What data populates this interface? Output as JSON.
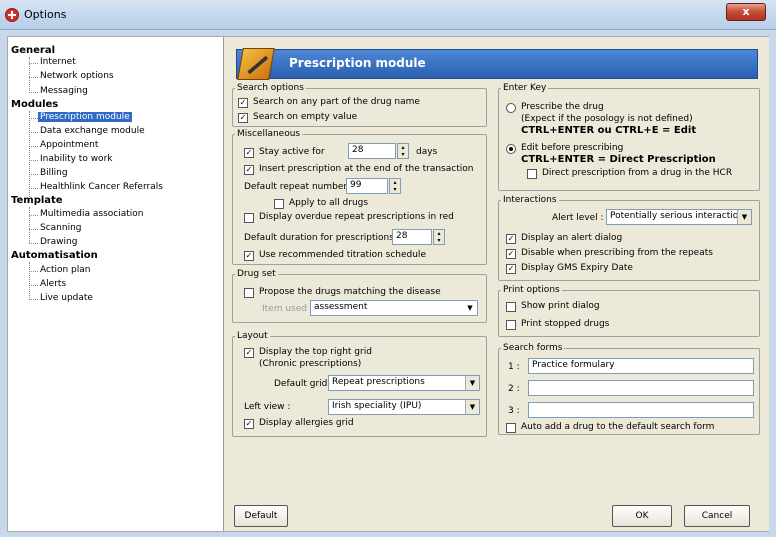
{
  "window": {
    "title": "Options",
    "close": "x"
  },
  "tree": {
    "general": "General",
    "internet": "Internet",
    "network": "Network options",
    "messaging": "Messaging",
    "modules": "Modules",
    "prescription": "Prescription module",
    "data_exchange": "Data exchange module",
    "appointment": "Appointment",
    "inability": "Inability to work",
    "billing": "Billing",
    "healthlink": "Healthlink Cancer Referrals",
    "template": "Template",
    "multimedia": "Multimedia association",
    "scanning": "Scanning",
    "drawing": "Drawing",
    "automatisation": "Automatisation",
    "action_plan": "Action plan",
    "alerts": "Alerts",
    "live_update": "Live update"
  },
  "header": {
    "title": "Prescription module"
  },
  "search_options": {
    "legend": "Search options",
    "any_part": "Search on any part of the drug name",
    "empty_value": "Search on empty value"
  },
  "misc": {
    "legend": "Miscellaneous",
    "stay_active": "Stay active for",
    "stay_value": "28",
    "days": "days",
    "insert_end": "Insert prescription at the end of the transaction",
    "repeat_label": "Default repeat number :",
    "repeat_value": "99",
    "apply_all": "Apply to all drugs",
    "overdue": "Display overdue repeat prescriptions in red",
    "duration_label": "Default duration for prescriptions :",
    "duration_value": "28",
    "titration": "Use recommended titration schedule"
  },
  "drug_set": {
    "legend": "Drug set",
    "propose": "Propose the drugs matching the disease",
    "item_used": "Item used :",
    "item_value": "assessment"
  },
  "layout": {
    "legend": "Layout",
    "top_right": "Display the top right grid",
    "chronic": "(Chronic prescriptions)",
    "default_grid_label": "Default grid :",
    "default_grid_value": "Repeat prescriptions",
    "left_view_label": "Left view :",
    "left_view_value": "Irish speciality (IPU)",
    "allergies": "Display allergies grid"
  },
  "enter_key": {
    "legend": "Enter Key",
    "prescribe": "Prescribe the drug",
    "except": "(Expect if the posology is not defined)",
    "ctrl_edit": "CTRL+ENTER ou CTRL+E = Edit",
    "edit_before": "Edit before prescribing",
    "ctrl_direct": "CTRL+ENTER = Direct Prescription",
    "direct_hcr": "Direct prescription from a drug in the HCR"
  },
  "interactions": {
    "legend": "Interactions",
    "alert_label": "Alert level :",
    "alert_value": "Potentially serious interaction",
    "display_alert": "Display an alert dialog",
    "disable_repeats": "Disable when prescribing from the repeats",
    "gms": "Display GMS Expiry Date"
  },
  "print": {
    "legend": "Print options",
    "show_dialog": "Show print dialog",
    "stopped": "Print stopped drugs"
  },
  "search_forms": {
    "legend": "Search forms",
    "l1": "1 :",
    "v1": "Practice formulary",
    "l2": "2 :",
    "v2": "",
    "l3": "3 :",
    "v3": "",
    "auto_add": "Auto add a drug to the default search form"
  },
  "buttons": {
    "default": "Default",
    "ok": "OK",
    "cancel": "Cancel"
  },
  "check": "✓"
}
